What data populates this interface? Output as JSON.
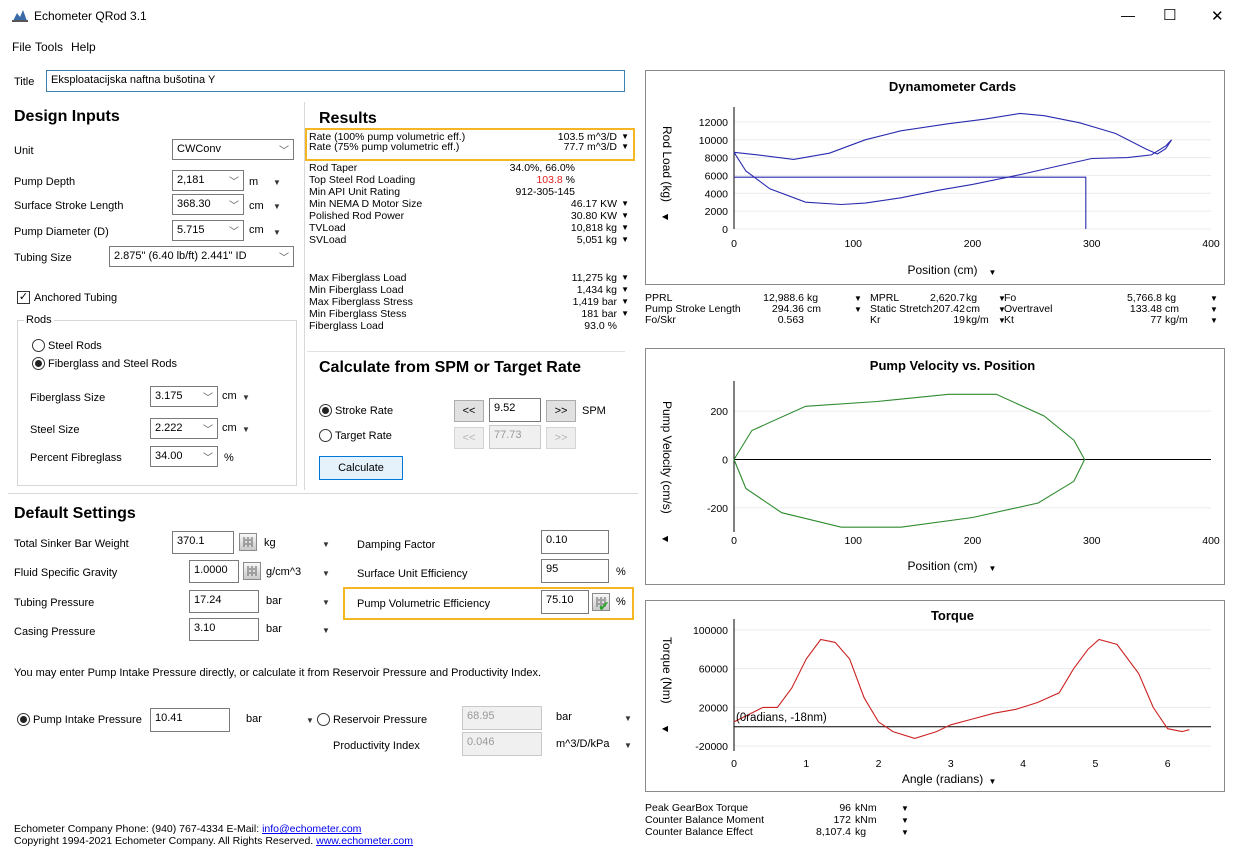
{
  "window": {
    "title": "Echometer QRod 3.1",
    "minimize": "—",
    "maximize": "☐",
    "close": "✕"
  },
  "menu": [
    "File",
    "Tools",
    "Help"
  ],
  "title_field": {
    "label": "Title",
    "value": "Eksploatacijska naftna bušotina Y"
  },
  "design": {
    "heading": "Design Inputs",
    "unit": {
      "label": "Unit",
      "value": "CWConv"
    },
    "pump_depth": {
      "label": "Pump Depth",
      "value": "2,181",
      "unit": "m"
    },
    "stroke_length": {
      "label": "Surface Stroke Length",
      "value": "368.30",
      "unit": "cm"
    },
    "pump_diameter": {
      "label": "Pump Diameter (D)",
      "value": "5.715",
      "unit": "cm"
    },
    "tubing_size": {
      "label": "Tubing Size",
      "value": "2.875\" (6.40 lb/ft) 2.441\" ID"
    },
    "anchored": {
      "label": "Anchored Tubing",
      "checked": true
    },
    "rods": {
      "group_label": "Rods",
      "steel_only": "Steel Rods",
      "fiberglass_steel": "Fiberglass and Steel Rods",
      "fiberglass_size": {
        "label": "Fiberglass Size",
        "value": "3.175",
        "unit": "cm"
      },
      "steel_size": {
        "label": "Steel Size",
        "value": "2.222",
        "unit": "cm"
      },
      "percent_fg": {
        "label": "Percent Fibreglass",
        "value": "34.00",
        "unit": "%"
      }
    }
  },
  "results": {
    "heading": "Results",
    "rows": [
      {
        "k": "Rate (100% pump volumetric eff.)",
        "v": "103.5 m^3/D",
        "arrow": true
      },
      {
        "k": "Rate (75% pump volumetric eff.)",
        "v": "77.7 m^3/D",
        "arrow": true
      },
      {
        "k": "Rod Taper",
        "v": "34.0%, 66.0%",
        "arrow": false
      },
      {
        "k": "Top Steel Rod Loading",
        "v": "103.8",
        "suffix": " %",
        "red": true,
        "arrow": false
      },
      {
        "k": "Min API Unit Rating",
        "v": "912-305-145",
        "arrow": false
      },
      {
        "k": "Min NEMA D Motor Size",
        "v": "46.17 KW",
        "arrow": true
      },
      {
        "k": "Polished Rod Power",
        "v": "30.80 KW",
        "arrow": true
      },
      {
        "k": "TVLoad",
        "v": "10,818 kg",
        "arrow": true
      },
      {
        "k": "SVLoad",
        "v": "5,051 kg",
        "arrow": true
      },
      {
        "k": "Max Fiberglass Load",
        "v": "11,275 kg",
        "arrow": true
      },
      {
        "k": "Min Fiberglass Load",
        "v": "1,434 kg",
        "arrow": true
      },
      {
        "k": "Max Fiberglass Stress",
        "v": "1,419 bar",
        "arrow": true
      },
      {
        "k": "Min Fiberglass Stess",
        "v": "181 bar",
        "arrow": true
      },
      {
        "k": "Fiberglass Load",
        "v": "93.0 %",
        "arrow": false
      }
    ]
  },
  "calc": {
    "heading": "Calculate from SPM or Target Rate",
    "stroke_rate": {
      "label": "Stroke Rate",
      "value": "9.52",
      "unit": "SPM"
    },
    "target_rate": {
      "label": "Target Rate",
      "value": "77.73"
    },
    "prev": "<<",
    "next": ">>",
    "button": "Calculate"
  },
  "defaults": {
    "heading": "Default Settings",
    "sinker": {
      "label": "Total Sinker Bar Weight",
      "value": "370.1",
      "unit": "kg"
    },
    "sg": {
      "label": "Fluid Specific Gravity",
      "value": "1.0000",
      "unit": "g/cm^3"
    },
    "tubing_p": {
      "label": "Tubing Pressure",
      "value": "17.24",
      "unit": "bar"
    },
    "casing_p": {
      "label": "Casing Pressure",
      "value": "3.10",
      "unit": "bar"
    },
    "damping": {
      "label": "Damping Factor",
      "value": "0.10"
    },
    "surface_eff": {
      "label": "Surface Unit Efficiency",
      "value": "95",
      "unit": "%"
    },
    "pump_eff": {
      "label": "Pump Volumetric Efficiency",
      "value": "75.10",
      "unit": "%"
    }
  },
  "intake": {
    "note": "You may enter Pump Intake Pressure directly, or calculate it from Reservoir Pressure and Productivity Index.",
    "pip": {
      "label": "Pump Intake Pressure",
      "value": "10.41",
      "unit": "bar"
    },
    "reservoir": {
      "label": "Reservoir Pressure",
      "value": "68.95",
      "unit": "bar"
    },
    "pi": {
      "label": "Productivity Index",
      "value": "0.046",
      "unit": "m^3/D/kPa"
    }
  },
  "footer": {
    "line1": "Echometer Company  Phone:  (940) 767-4334  E-Mail: ",
    "email": "info@echometer.com",
    "line2": "Copyright 1994-2021 Echometer Company. All Rights Reserved. ",
    "web": "www.echometer.com"
  },
  "dyno": {
    "title": "Dynamometer Cards",
    "ylabel": "Rod Load (kg)",
    "xlabel": "Position (cm)",
    "yticks": [
      "12000",
      "10000",
      "8000",
      "6000",
      "4000",
      "2000",
      "0"
    ],
    "xticks": [
      "0",
      "100",
      "200",
      "300",
      "400"
    ]
  },
  "dyno_stats": {
    "pprl": {
      "k": "PPRL",
      "v": "12,988.6",
      "u": "kg"
    },
    "psl": {
      "k": "Pump Stroke Length",
      "v": "294.36",
      "u": "cm"
    },
    "foskr": {
      "k": "Fo/Skr",
      "v": "0.563"
    },
    "mprl": {
      "k": "MPRL",
      "v": "2,620.7",
      "u": "kg"
    },
    "stretch": {
      "k": "Static Stretch",
      "v": "207.42",
      "u": "cm"
    },
    "kr": {
      "k": "Kr",
      "v": "19",
      "u": "kg/m"
    },
    "fo": {
      "k": "Fo",
      "v": "5,766.8",
      "u": "kg"
    },
    "overtravel": {
      "k": "Overtravel",
      "v": "133.48",
      "u": "cm"
    },
    "kt": {
      "k": "Kt",
      "v": "77",
      "u": "kg/m"
    }
  },
  "velocity": {
    "title": "Pump Velocity vs. Position",
    "ylabel": "Pump Velocity (cm/s)",
    "xlabel": "Position (cm)",
    "yticks": [
      "200",
      "0",
      "-200"
    ],
    "xticks": [
      "0",
      "100",
      "200",
      "300",
      "400"
    ]
  },
  "torque": {
    "title": "Torque",
    "ylabel": "Torque (Nm)",
    "xlabel": "Angle (radians)",
    "yticks": [
      "100000",
      "60000",
      "20000",
      "-20000"
    ],
    "xticks": [
      "0",
      "1",
      "2",
      "3",
      "4",
      "5",
      "6"
    ],
    "annotation": "(0radians, -18nm)"
  },
  "torque_stats": {
    "peak": {
      "k": "Peak GearBox Torque",
      "v": "96",
      "u": "kNm"
    },
    "cbm": {
      "k": "Counter Balance Moment",
      "v": "172",
      "u": "kNm"
    },
    "cbe": {
      "k": "Counter Balance Effect",
      "v": "8,107.4",
      "u": "kg"
    }
  },
  "colors": {
    "dyno": "#2b2bb0",
    "velocity": "#2e8b2e",
    "torque": "#cc2222",
    "highlight": "#f4b621",
    "red_value": "#e02020"
  },
  "chart_data": [
    {
      "type": "line",
      "title": "Dynamometer Cards",
      "xlabel": "Position (cm)",
      "ylabel": "Rod Load (kg)",
      "xlim": [
        0,
        400
      ],
      "ylim": [
        0,
        13000
      ],
      "series": [
        {
          "values_xy": [
            [
              0,
              8600
            ],
            [
              20,
              8300
            ],
            [
              50,
              7800
            ],
            [
              80,
              8500
            ],
            [
              110,
              10000
            ],
            [
              140,
              11000
            ],
            [
              180,
              11800
            ],
            [
              210,
              12300
            ],
            [
              240,
              12950
            ],
            [
              260,
              12700
            ],
            [
              290,
              11900
            ],
            [
              320,
              10700
            ],
            [
              345,
              9000
            ],
            [
              355,
              8400
            ],
            [
              362,
              9000
            ],
            [
              367,
              10000
            ],
            [
              362,
              9300
            ],
            [
              350,
              8300
            ],
            [
              330,
              8000
            ],
            [
              300,
              7900
            ],
            [
              270,
              7000
            ],
            [
              240,
              6100
            ],
            [
              200,
              5000
            ],
            [
              170,
              4300
            ],
            [
              140,
              3500
            ],
            [
              110,
              2900
            ],
            [
              90,
              2750
            ],
            [
              60,
              3000
            ],
            [
              30,
              4500
            ],
            [
              10,
              6500
            ],
            [
              0,
              8600
            ]
          ]
        },
        {
          "values_xy": [
            [
              0,
              5800
            ],
            [
              295,
              5800
            ],
            [
              295,
              0
            ]
          ]
        }
      ]
    },
    {
      "type": "line",
      "title": "Pump Velocity vs. Position",
      "xlabel": "Position (cm)",
      "ylabel": "Pump Velocity (cm/s)",
      "xlim": [
        0,
        400
      ],
      "ylim": [
        -300,
        300
      ],
      "series": [
        {
          "values_xy": [
            [
              0,
              0
            ],
            [
              15,
              120
            ],
            [
              60,
              220
            ],
            [
              120,
              240
            ],
            [
              180,
              270
            ],
            [
              220,
              270
            ],
            [
              260,
              180
            ],
            [
              285,
              80
            ],
            [
              294,
              0
            ],
            [
              285,
              -90
            ],
            [
              255,
              -180
            ],
            [
              200,
              -240
            ],
            [
              140,
              -280
            ],
            [
              90,
              -280
            ],
            [
              40,
              -220
            ],
            [
              10,
              -120
            ],
            [
              0,
              0
            ]
          ]
        }
      ]
    },
    {
      "type": "line",
      "title": "Torque",
      "xlabel": "Angle (radians)",
      "ylabel": "Torque (Nm)",
      "xlim": [
        0,
        6.6
      ],
      "ylim": [
        -25000,
        105000
      ],
      "series": [
        {
          "values_xy": [
            [
              0,
              5000
            ],
            [
              0.4,
              20000
            ],
            [
              0.6,
              20000
            ],
            [
              0.8,
              40000
            ],
            [
              1.0,
              70000
            ],
            [
              1.2,
              90000
            ],
            [
              1.4,
              87000
            ],
            [
              1.6,
              70000
            ],
            [
              1.8,
              30000
            ],
            [
              2.0,
              5000
            ],
            [
              2.2,
              -5000
            ],
            [
              2.5,
              -12000
            ],
            [
              2.8,
              -5000
            ],
            [
              3.0,
              2000
            ],
            [
              3.3,
              8000
            ],
            [
              3.6,
              14000
            ],
            [
              3.9,
              18000
            ],
            [
              4.2,
              25000
            ],
            [
              4.5,
              35000
            ],
            [
              4.7,
              60000
            ],
            [
              4.9,
              80000
            ],
            [
              5.05,
              90000
            ],
            [
              5.3,
              85000
            ],
            [
              5.6,
              55000
            ],
            [
              5.8,
              20000
            ],
            [
              6.0,
              -2000
            ],
            [
              6.2,
              -5000
            ],
            [
              6.3,
              -3000
            ]
          ]
        }
      ]
    }
  ]
}
